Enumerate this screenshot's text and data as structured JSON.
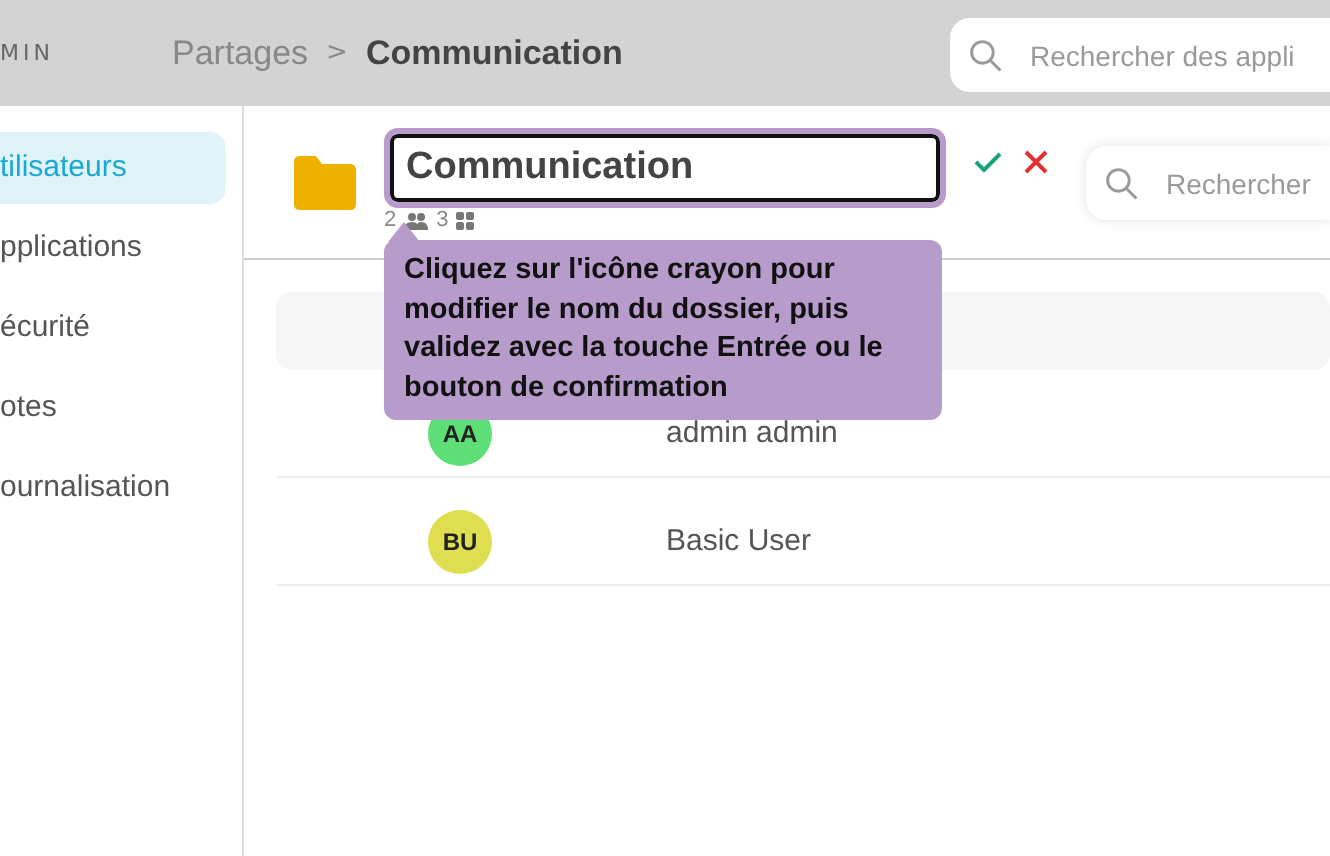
{
  "header": {
    "brand": "MIN",
    "breadcrumb": [
      {
        "label": "Partages",
        "current": false
      },
      {
        "label": "Communication",
        "current": true
      }
    ],
    "separator": ">",
    "search": {
      "placeholder": "Rechercher des appli"
    }
  },
  "sidebar": {
    "items": [
      {
        "label": "tilisateurs",
        "selected": true
      },
      {
        "label": "pplications",
        "selected": false
      },
      {
        "label": "écurité",
        "selected": false
      },
      {
        "label": "otes",
        "selected": false
      },
      {
        "label": "ournalisation",
        "selected": false
      }
    ]
  },
  "folder": {
    "name": "Communication",
    "users_count": "2",
    "apps_count": "3"
  },
  "members_search": {
    "placeholder": "Rechercher"
  },
  "members": [
    {
      "initials": "AA",
      "name": "admin admin",
      "color": "#5ede76"
    },
    {
      "initials": "BU",
      "name": "Basic User",
      "color": "#dede50"
    }
  ],
  "tooltip": "Cliquez sur l'icône crayon pour modifier le nom du dossier, puis validez avec la touche Entrée ou le bouton de confirmation"
}
